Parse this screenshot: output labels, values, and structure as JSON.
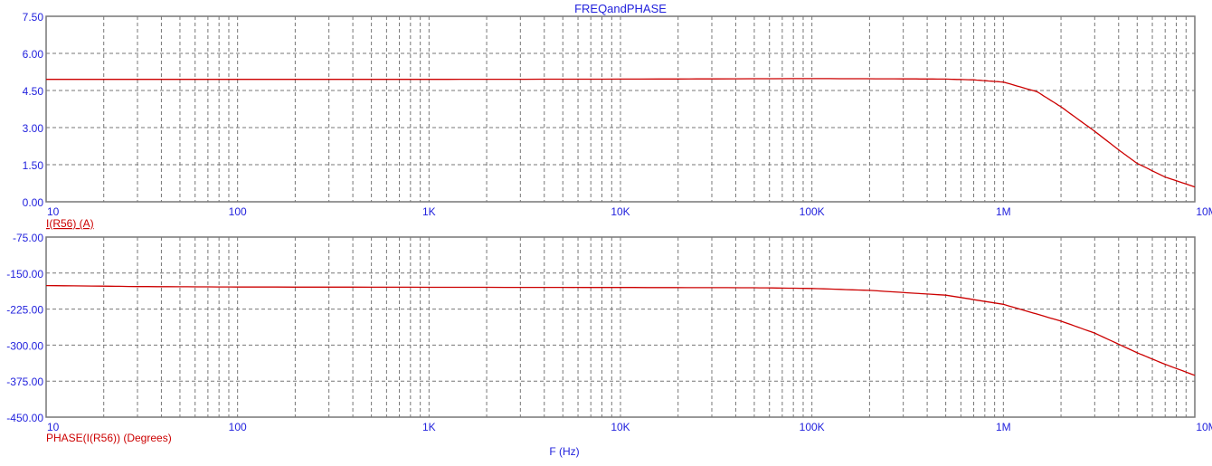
{
  "chart_data": [
    {
      "type": "line",
      "title": "FREQandPHASE",
      "xscale": "log",
      "xlim": [
        10,
        10000000
      ],
      "xticks": [
        10,
        100,
        1000,
        10000,
        100000,
        1000000,
        10000000
      ],
      "xtick_labels": [
        "10",
        "100",
        "1K",
        "10K",
        "100K",
        "1M",
        "10M"
      ],
      "ylim": [
        0,
        7.5
      ],
      "yticks": [
        0,
        1.5,
        3,
        4.5,
        6,
        7.5
      ],
      "ytick_labels": [
        "0.00",
        "1.50",
        "3.00",
        "4.50",
        "6.00",
        "7.50"
      ],
      "grid": true,
      "series": [
        {
          "name": "I(R56) (A)",
          "color": "#cc0000",
          "x": [
            10,
            100,
            1000,
            10000,
            100000,
            300000,
            500000,
            700000,
            1000000,
            1500000,
            2000000,
            3000000,
            4000000,
            5000000,
            7000000,
            10000000
          ],
          "y": [
            4.95,
            4.95,
            4.95,
            4.96,
            4.98,
            4.97,
            4.96,
            4.93,
            4.84,
            4.45,
            3.84,
            2.85,
            2.1,
            1.55,
            1.0,
            0.6
          ]
        }
      ]
    },
    {
      "type": "line",
      "xscale": "log",
      "xlabel": "F (Hz)",
      "xlim": [
        10,
        10000000
      ],
      "xticks": [
        10,
        100,
        1000,
        10000,
        100000,
        1000000,
        10000000
      ],
      "xtick_labels": [
        "10",
        "100",
        "1K",
        "10K",
        "100K",
        "1M",
        "10M"
      ],
      "ylim": [
        -450,
        -75
      ],
      "yticks": [
        -450,
        -375,
        -300,
        -225,
        -150,
        -75
      ],
      "ytick_labels": [
        "-450.00",
        "-375.00",
        "-300.00",
        "-225.00",
        "-150.00",
        "-75.00"
      ],
      "grid": true,
      "series": [
        {
          "name": "PHASE(I(R56)) (Degrees)",
          "color": "#cc0000",
          "x": [
            10,
            30,
            100,
            1000,
            10000,
            50000,
            100000,
            200000,
            500000,
            1000000,
            2000000,
            3000000,
            5000000,
            7000000,
            10000000
          ],
          "y": [
            -176,
            -178,
            -179,
            -179.5,
            -180,
            -180.5,
            -182,
            -186,
            -196,
            -215,
            -250,
            -275,
            -316,
            -340,
            -363
          ]
        }
      ]
    }
  ]
}
